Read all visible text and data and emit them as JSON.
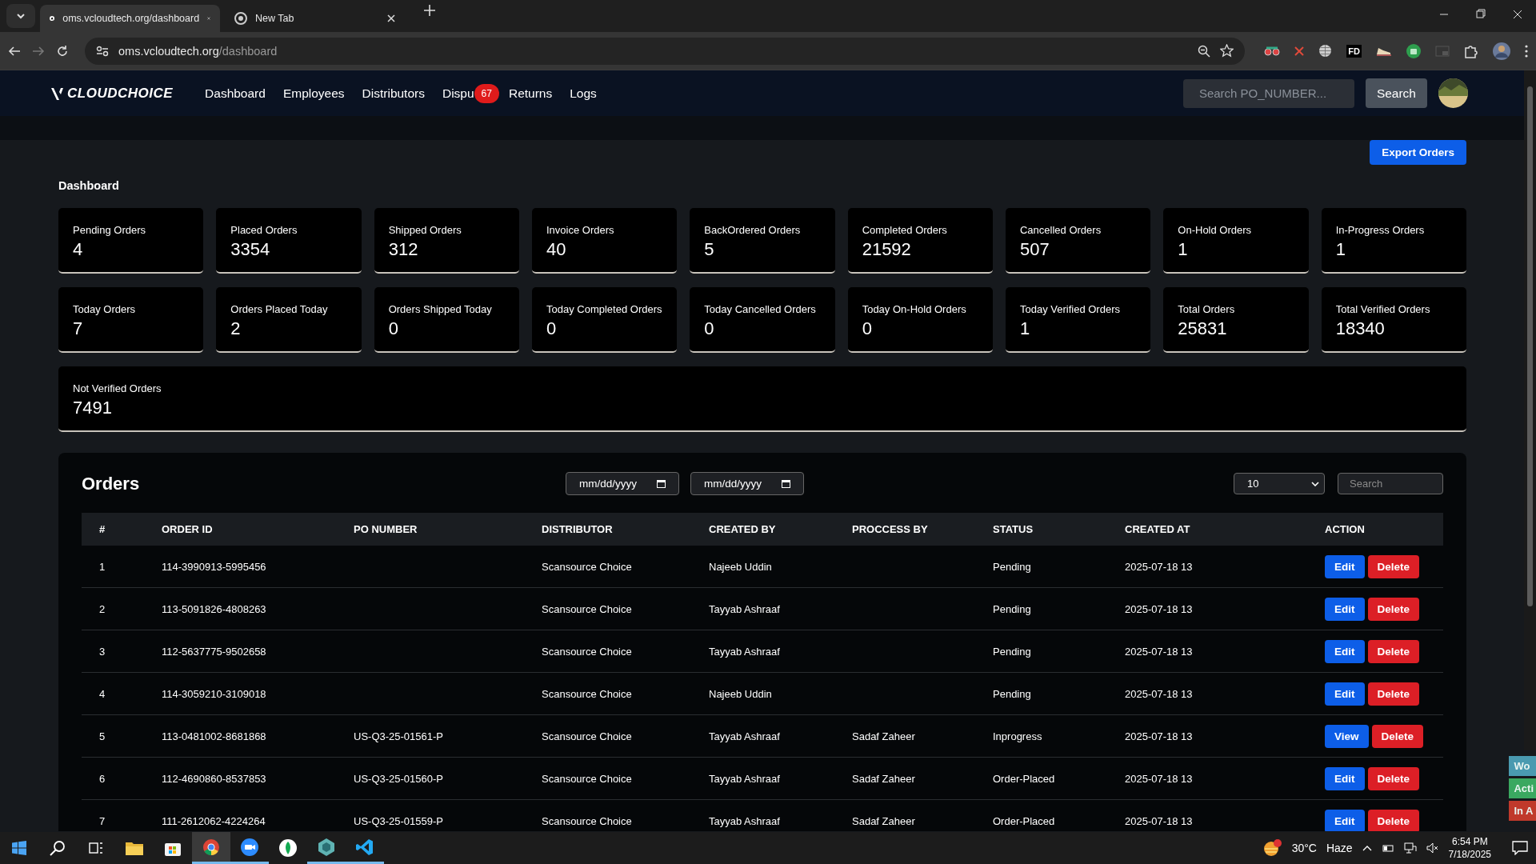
{
  "browser": {
    "tabs": [
      {
        "title": "oms.vcloudtech.org/dashboard",
        "selected": true
      },
      {
        "title": "New Tab",
        "selected": false
      }
    ],
    "url_host": "oms.vcloudtech.org",
    "url_path": "/dashboard",
    "extension_label": "FD"
  },
  "navbar": {
    "logo": "CLOUDCHOICE",
    "items": [
      {
        "label": "Dashboard"
      },
      {
        "label": "Employees"
      },
      {
        "label": "Distributors"
      },
      {
        "label": "Dispu",
        "badge": "67"
      },
      {
        "label": "Returns"
      },
      {
        "label": "Logs"
      }
    ],
    "search": {
      "placeholder": "Search PO_NUMBER..."
    },
    "search_button": "Search"
  },
  "export_button": "Export Orders",
  "heading": "Dashboard",
  "stats": [
    {
      "label": "Pending Orders",
      "value": "4"
    },
    {
      "label": "Placed Orders",
      "value": "3354"
    },
    {
      "label": "Shipped Orders",
      "value": "312"
    },
    {
      "label": "Invoice Orders",
      "value": "40"
    },
    {
      "label": "BackOrdered Orders",
      "value": "5"
    },
    {
      "label": "Completed Orders",
      "value": "21592"
    },
    {
      "label": "Cancelled Orders",
      "value": "507"
    },
    {
      "label": "On-Hold Orders",
      "value": "1"
    },
    {
      "label": "In-Progress Orders",
      "value": "1"
    },
    {
      "label": "Today Orders",
      "value": "7"
    },
    {
      "label": "Orders Placed Today",
      "value": "2"
    },
    {
      "label": "Orders Shipped Today",
      "value": "0"
    },
    {
      "label": "Today Completed Orders",
      "value": "0"
    },
    {
      "label": "Today Cancelled Orders",
      "value": "0"
    },
    {
      "label": "Today On-Hold Orders",
      "value": "0"
    },
    {
      "label": "Today Verified Orders",
      "value": "1"
    },
    {
      "label": "Total Orders",
      "value": "25831"
    },
    {
      "label": "Total Verified Orders",
      "value": "18340"
    },
    {
      "label": "Not Verified Orders",
      "value": "7491",
      "wide": true
    }
  ],
  "orders": {
    "title": "Orders",
    "date_from": {
      "placeholder": "mm/dd/yyyy"
    },
    "date_to": {
      "placeholder": "mm/dd/yyyy"
    },
    "page_size": "10",
    "search": {
      "placeholder": "Search"
    },
    "columns": [
      "#",
      "ORDER ID",
      "PO NUMBER",
      "DISTRIBUTOR",
      "CREATED BY",
      "PROCCESS BY",
      "STATUS",
      "CREATED AT",
      "ACTION"
    ],
    "rows": [
      {
        "cells": [
          "1",
          "114-3990913-5995456",
          "",
          "Scansource Choice",
          "Najeeb Uddin",
          "",
          "Pending",
          "2025-07-18 13"
        ],
        "actions": [
          {
            "label": "Edit",
            "kind": "primary"
          },
          {
            "label": "Delete",
            "kind": "danger"
          }
        ]
      },
      {
        "cells": [
          "2",
          "113-5091826-4808263",
          "",
          "Scansource Choice",
          "Tayyab Ashraaf",
          "",
          "Pending",
          "2025-07-18 13"
        ],
        "actions": [
          {
            "label": "Edit",
            "kind": "primary"
          },
          {
            "label": "Delete",
            "kind": "danger"
          }
        ]
      },
      {
        "cells": [
          "3",
          "112-5637775-9502658",
          "",
          "Scansource Choice",
          "Tayyab Ashraaf",
          "",
          "Pending",
          "2025-07-18 13"
        ],
        "actions": [
          {
            "label": "Edit",
            "kind": "primary"
          },
          {
            "label": "Delete",
            "kind": "danger"
          }
        ]
      },
      {
        "cells": [
          "4",
          "114-3059210-3109018",
          "",
          "Scansource Choice",
          "Najeeb Uddin",
          "",
          "Pending",
          "2025-07-18 13"
        ],
        "actions": [
          {
            "label": "Edit",
            "kind": "primary"
          },
          {
            "label": "Delete",
            "kind": "danger"
          }
        ]
      },
      {
        "cells": [
          "5",
          "113-0481002-8681868",
          "US-Q3-25-01561-P",
          "Scansource Choice",
          "Tayyab Ashraaf",
          "Sadaf Zaheer",
          "Inprogress",
          "2025-07-18 13"
        ],
        "actions": [
          {
            "label": "View",
            "kind": "primary"
          },
          {
            "label": "Delete",
            "kind": "danger"
          }
        ]
      },
      {
        "cells": [
          "6",
          "112-4690860-8537853",
          "US-Q3-25-01560-P",
          "Scansource Choice",
          "Tayyab Ashraaf",
          "Sadaf Zaheer",
          "Order-Placed",
          "2025-07-18 13"
        ],
        "actions": [
          {
            "label": "Edit",
            "kind": "primary"
          },
          {
            "label": "Delete",
            "kind": "danger"
          }
        ]
      },
      {
        "cells": [
          "7",
          "111-2612062-4224264",
          "US-Q3-25-01559-P",
          "Scansource Choice",
          "Tayyab Ashraaf",
          "Sadaf Zaheer",
          "Order-Placed",
          "2025-07-18 13"
        ],
        "actions": [
          {
            "label": "Edit",
            "kind": "primary"
          },
          {
            "label": "Delete",
            "kind": "danger"
          }
        ]
      }
    ]
  },
  "side_tabs": [
    {
      "label": "Wo",
      "color": "#4a9ab0"
    },
    {
      "label": "Acti",
      "color": "#3aa860"
    },
    {
      "label": "In A",
      "color": "#c0392b"
    }
  ],
  "taskbar": {
    "apps": [
      {
        "kind": "explorer",
        "running": false,
        "selected": false
      },
      {
        "kind": "store",
        "running": false,
        "selected": false
      },
      {
        "kind": "chrome",
        "running": true,
        "selected": true
      },
      {
        "kind": "zoom",
        "running": true,
        "selected": false
      },
      {
        "kind": "leaf",
        "running": false,
        "selected": false
      },
      {
        "kind": "hex",
        "running": true,
        "selected": false
      },
      {
        "kind": "vscode",
        "running": true,
        "selected": false
      }
    ],
    "temperature": "30°C",
    "weather": "Haze",
    "time": "6:54 PM",
    "date": "7/18/2025"
  }
}
